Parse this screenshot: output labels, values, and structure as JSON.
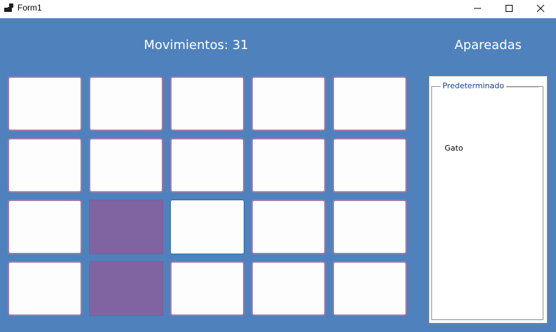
{
  "window": {
    "title": "Form1",
    "minimize_symbol": "—",
    "maximize_symbol": "☐",
    "close_symbol": "✕"
  },
  "game": {
    "moves_text": "Movimientos: 31",
    "grid": {
      "rows": 4,
      "cols": 5,
      "cards": [
        "hidden",
        "hidden",
        "hidden",
        "hidden",
        "hidden",
        "hidden",
        "hidden",
        "hidden",
        "hidden",
        "hidden",
        "hidden",
        "revealed",
        "focused",
        "hidden",
        "hidden",
        "hidden",
        "revealed",
        "hidden",
        "hidden",
        "hidden"
      ]
    }
  },
  "matched_panel": {
    "title": "Apareadas",
    "group_label": "Predeterminado",
    "items": [
      "Gato"
    ]
  },
  "colors": {
    "background": "#4f81bd",
    "card_face": "#fdfdfd",
    "card_border": "#a07ba8",
    "card_revealed": "#8064a2",
    "group_label": "#1a3f95"
  }
}
